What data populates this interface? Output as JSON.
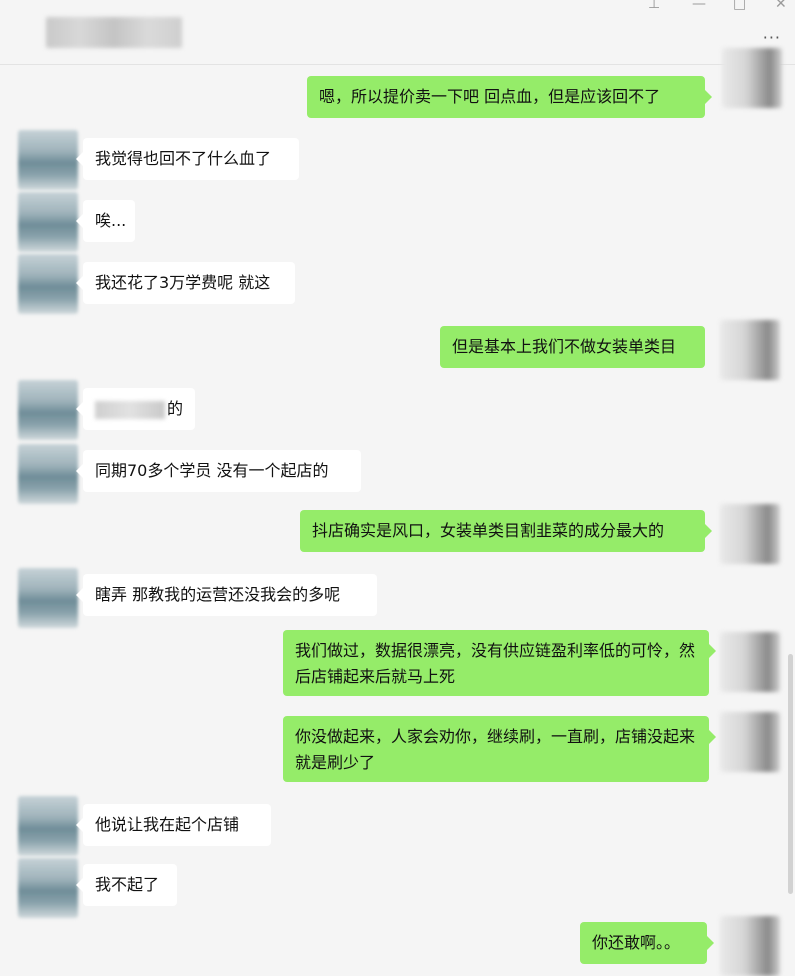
{
  "window": {
    "controls": {
      "pin": "⊥",
      "minimize": "—",
      "maximize": "□",
      "close": "✕"
    },
    "more_label": "···"
  },
  "messages": [
    {
      "side": "right",
      "text": "嗯，所以提价卖一下吧  回点血，但是应该回不了"
    },
    {
      "side": "left",
      "text": "我觉得也回不了什么血了"
    },
    {
      "side": "left",
      "text": "唉..."
    },
    {
      "side": "left",
      "text": "我还花了3万学费呢 就这"
    },
    {
      "side": "right",
      "text": "但是基本上我们不做女装单类目"
    },
    {
      "side": "left",
      "text": "的"
    },
    {
      "side": "left",
      "text": "同期70多个学员 没有一个起店的"
    },
    {
      "side": "right",
      "text": "抖店确实是风口，女装单类目割韭菜的成分最大的"
    },
    {
      "side": "left",
      "text": "瞎弄 那教我的运营还没我会的多呢"
    },
    {
      "side": "right",
      "text": "我们做过，数据很漂亮，没有供应链盈利率低的可怜，然后店铺起来后就马上死"
    },
    {
      "side": "right",
      "text": "你没做起来，人家会劝你，继续刷，一直刷，店铺没起来就是刷少了"
    },
    {
      "side": "left",
      "text": "他说让我在起个店铺"
    },
    {
      "side": "left",
      "text": "我不起了"
    },
    {
      "side": "right",
      "text": "你还敢啊。。"
    }
  ]
}
